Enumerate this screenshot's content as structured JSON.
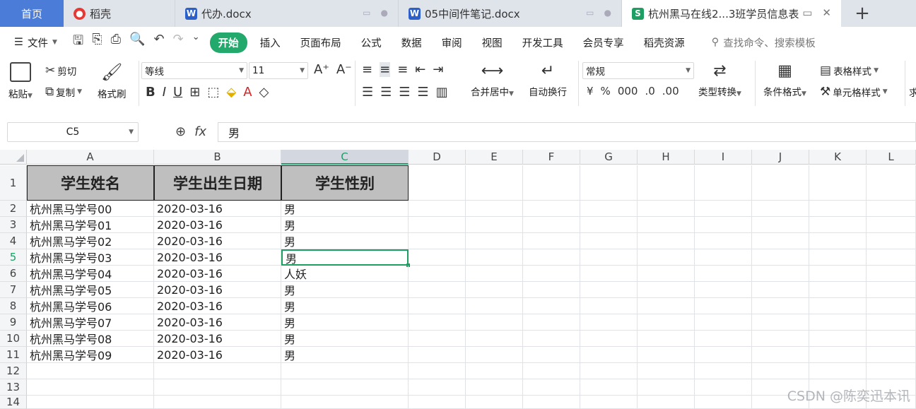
{
  "tabs": {
    "home": "首页",
    "t1": "稻壳",
    "t2": "代办.docx",
    "t3": "05中间件笔记.docx",
    "active": "杭州黑马在线2...3班学员信息表"
  },
  "menu": {
    "file": "文件",
    "items": [
      "开始",
      "插入",
      "页面布局",
      "公式",
      "数据",
      "审阅",
      "视图",
      "开发工具",
      "会员专享",
      "稻壳资源"
    ],
    "search_placeholder": "查找命令、搜索模板"
  },
  "ribbon": {
    "paste": "粘贴",
    "cut": "剪切",
    "copy": "复制",
    "format_painter": "格式刷",
    "font_name": "等线",
    "font_size": "11",
    "merge_center": "合并居中",
    "wrap_text": "自动换行",
    "number_format": "常规",
    "type_convert": "类型转换",
    "conditional_format": "条件格式",
    "table_style": "表格样式",
    "cell_style": "单元格样式",
    "more": "求"
  },
  "formula_bar": {
    "cell_ref": "C5",
    "fx": "fx",
    "value": "男"
  },
  "grid": {
    "columns": [
      "A",
      "B",
      "C",
      "D",
      "E",
      "F",
      "G",
      "H",
      "I",
      "J",
      "K",
      "L"
    ],
    "selected_column": "C",
    "selected_row": 5,
    "header": [
      "学生姓名",
      "学生出生日期",
      "学生性别"
    ],
    "rows": [
      [
        "杭州黑马学号00",
        "2020-03-16",
        "男"
      ],
      [
        "杭州黑马学号01",
        "2020-03-16",
        "男"
      ],
      [
        "杭州黑马学号02",
        "2020-03-16",
        "男"
      ],
      [
        "杭州黑马学号03",
        "2020-03-16",
        "男"
      ],
      [
        "杭州黑马学号04",
        "2020-03-16",
        "人妖"
      ],
      [
        "杭州黑马学号05",
        "2020-03-16",
        "男"
      ],
      [
        "杭州黑马学号06",
        "2020-03-16",
        "男"
      ],
      [
        "杭州黑马学号07",
        "2020-03-16",
        "男"
      ],
      [
        "杭州黑马学号08",
        "2020-03-16",
        "男"
      ],
      [
        "杭州黑马学号09",
        "2020-03-16",
        "男"
      ]
    ],
    "row_numbers": [
      1,
      2,
      3,
      4,
      5,
      6,
      7,
      8,
      9,
      10,
      11,
      12,
      13,
      14
    ]
  },
  "watermark": "CSDN @陈奕迅本讯",
  "colors": {
    "accent": "#22a96b",
    "home_tab": "#4a7cd8",
    "header_fill": "#bfbfbf"
  }
}
